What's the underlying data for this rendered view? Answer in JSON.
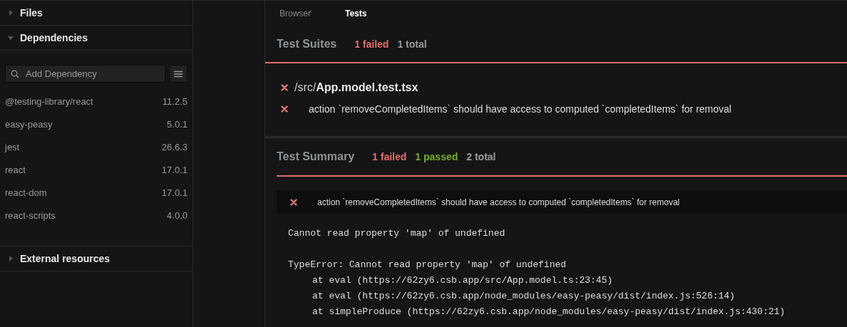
{
  "sidebar": {
    "sections": [
      {
        "title": "Files",
        "expanded": false
      },
      {
        "title": "Dependencies",
        "expanded": true
      },
      {
        "title": "External resources",
        "expanded": false
      }
    ],
    "search": {
      "placeholder": "Add Dependency"
    },
    "dependencies": [
      {
        "name": "@testing-library/react",
        "version": "11.2.5"
      },
      {
        "name": "easy-peasy",
        "version": "5.0.1"
      },
      {
        "name": "jest",
        "version": "26.6.3"
      },
      {
        "name": "react",
        "version": "17.0.1"
      },
      {
        "name": "react-dom",
        "version": "17.0.1"
      },
      {
        "name": "react-scripts",
        "version": "4.0.0"
      }
    ]
  },
  "tabs": [
    {
      "label": "Browser",
      "selected": false
    },
    {
      "label": "Tests",
      "selected": true
    }
  ],
  "test_suites": {
    "title": "Test Suites",
    "stats": [
      {
        "kind": "failed",
        "text": "1 failed"
      },
      {
        "kind": "total",
        "text": "1 total"
      }
    ],
    "file": {
      "path": "/src/**App.model.test.tsx**",
      "kind": "failed"
    },
    "tests": [
      {
        "name": "action `removeCompletedItems` should have access to computed `completedItems` for removal",
        "kind": "failed"
      }
    ]
  },
  "test_summary": {
    "title": "Test Summary",
    "stats": [
      {
        "kind": "failed",
        "text": "1 failed"
      },
      {
        "kind": "passed",
        "text": "1 passed"
      },
      {
        "kind": "total",
        "text": "2 total"
      }
    ],
    "failure": {
      "name": "action `removeCompletedItems` should have access to computed `completedItems` for removal",
      "kind": "failed"
    },
    "error": {
      "message": "Cannot read property 'map' of undefined",
      "stack_header": "TypeError: Cannot read property 'map' of undefined",
      "frames": [
        "at eval (https://62zy6.csb.app/src/App.model.ts:23:45)",
        "at eval (https://62zy6.csb.app/node_modules/easy-peasy/dist/index.js:526:14)",
        "at simpleProduce (https://62zy6.csb.app/node_modules/easy-peasy/dist/index.js:430:21)"
      ]
    }
  }
}
